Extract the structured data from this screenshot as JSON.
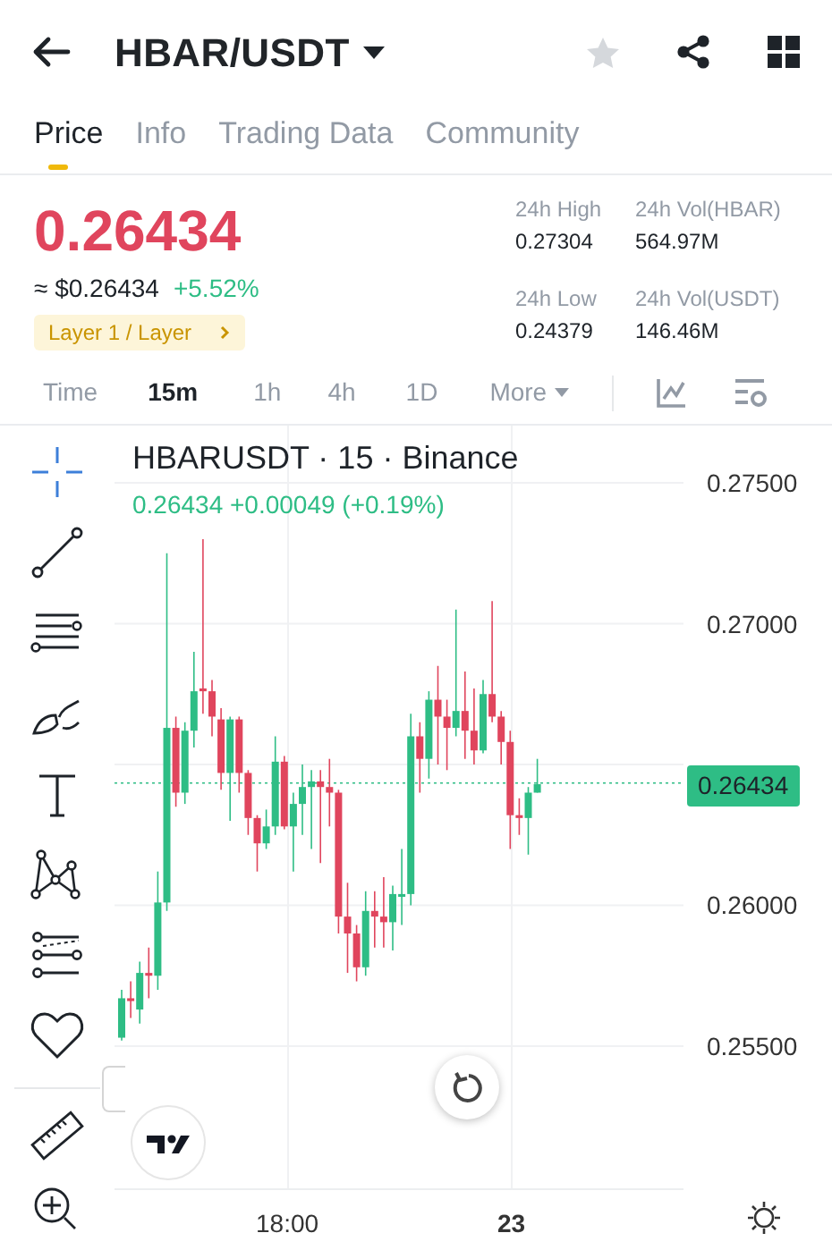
{
  "header": {
    "pair": "HBAR/USDT",
    "favorite": false
  },
  "tabs": [
    {
      "label": "Price",
      "selected": true
    },
    {
      "label": "Info",
      "selected": false
    },
    {
      "label": "Trading Data",
      "selected": false
    },
    {
      "label": "Community",
      "selected": false
    }
  ],
  "price": {
    "last": "0.26434",
    "fiat": "≈ $0.26434",
    "change": "+5.52%",
    "tag": "Layer 1 / Layer"
  },
  "stats": [
    {
      "label": "24h High",
      "value": "0.27304"
    },
    {
      "label": "24h Vol(HBAR)",
      "value": "564.97M"
    },
    {
      "label": "24h Low",
      "value": "0.24379"
    },
    {
      "label": "24h Vol(USDT)",
      "value": "146.46M"
    }
  ],
  "intervals": [
    {
      "label": "Time",
      "selected": false
    },
    {
      "label": "15m",
      "selected": true
    },
    {
      "label": "1h",
      "selected": false
    },
    {
      "label": "4h",
      "selected": false
    },
    {
      "label": "1D",
      "selected": false
    },
    {
      "label": "More",
      "selected": false
    }
  ],
  "chart": {
    "title": "HBARUSDT · 15 · Binance",
    "ohlc": "0.26434  +0.00049 (+0.19%)",
    "crosshair_active": true,
    "price_axis": [
      "0.27500",
      "0.27000",
      "0.26000",
      "0.25500"
    ],
    "time_axis": [
      "18:00",
      "23"
    ],
    "last_price_tag": "0.26434"
  }
}
